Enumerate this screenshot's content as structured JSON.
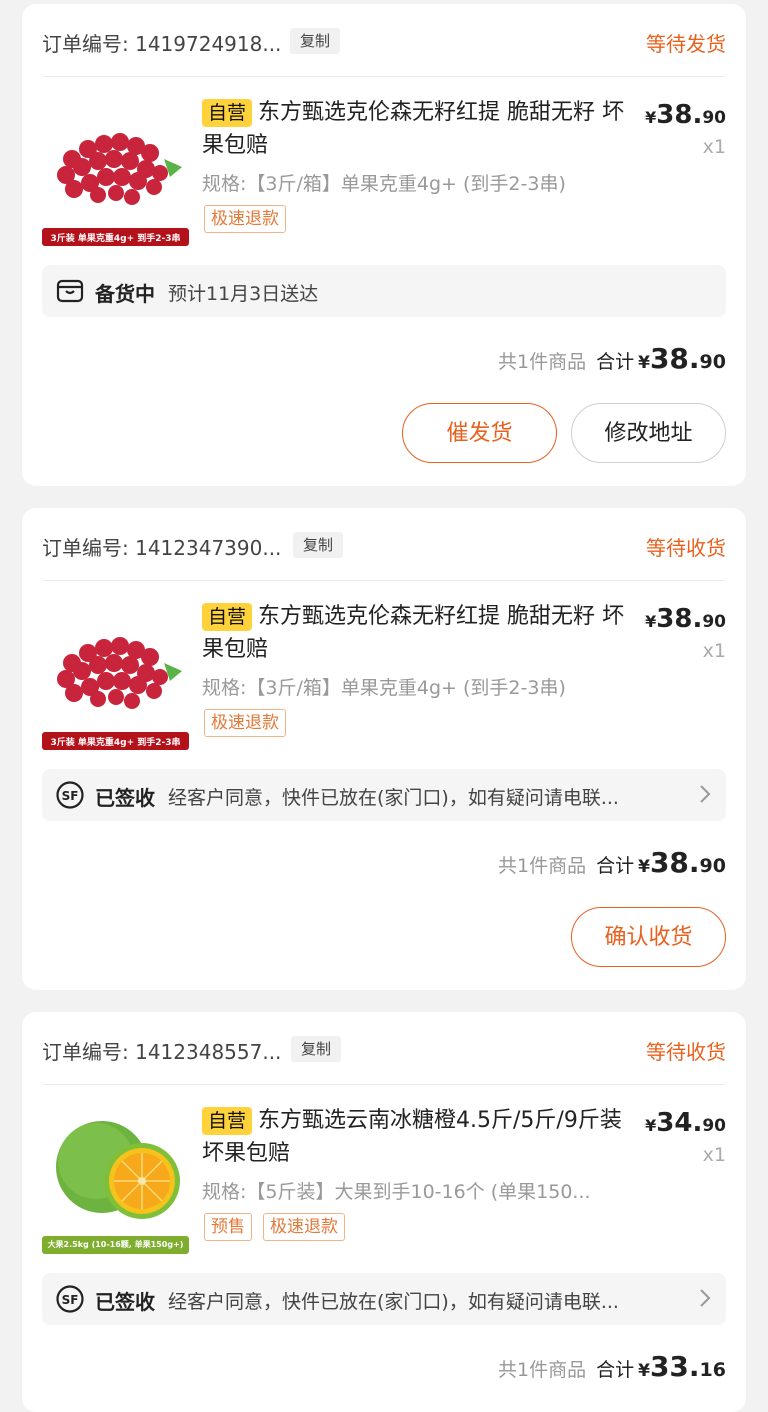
{
  "orders": [
    {
      "order_no_label": "订单编号: 1419724918...",
      "copy_label": "复制",
      "status": "等待发货",
      "self_tag": "自营",
      "product_title": "东方甄选克伦森无籽红提 脆甜无籽 坏果包赔",
      "spec": "规格:【3斤/箱】单果克重4g+ (到手2-3串)",
      "tags": [
        "极速退款"
      ],
      "price_currency": "¥",
      "price_int": "38.",
      "price_dec": "90",
      "qty": "x1",
      "image_caption": "3斤装 单果克重4g+ 到手2-3串",
      "image_icon": "grape-icon",
      "logistics_icon": "package-box-icon",
      "logistics_status": "备货中",
      "logistics_text": "预计11月3日送达",
      "summary_count": "共1件商品",
      "summary_label": "合计",
      "total_currency": "¥",
      "total_int": "38.",
      "total_dec": "90",
      "buttons": [
        "催发货",
        "修改地址"
      ]
    },
    {
      "order_no_label": "订单编号: 1412347390...",
      "copy_label": "复制",
      "status": "等待收货",
      "self_tag": "自营",
      "product_title": "东方甄选克伦森无籽红提 脆甜无籽 坏果包赔",
      "spec": "规格:【3斤/箱】单果克重4g+ (到手2-3串)",
      "tags": [
        "极速退款"
      ],
      "price_currency": "¥",
      "price_int": "38.",
      "price_dec": "90",
      "qty": "x1",
      "image_caption": "3斤装 单果克重4g+ 到手2-3串",
      "image_icon": "grape-icon",
      "logistics_icon": "sf-express-icon",
      "logistics_status": "已签收",
      "logistics_text": "经客户同意，快件已放在(家门口)，如有疑问请电联...",
      "summary_count": "共1件商品",
      "summary_label": "合计",
      "total_currency": "¥",
      "total_int": "38.",
      "total_dec": "90",
      "buttons": [
        "确认收货"
      ]
    },
    {
      "order_no_label": "订单编号: 1412348557...",
      "copy_label": "复制",
      "status": "等待收货",
      "self_tag": "自营",
      "product_title": "东方甄选云南冰糖橙4.5斤/5斤/9斤装 坏果包赔",
      "spec": "规格:【5斤装】大果到手10-16个 (单果150...",
      "tags": [
        "预售",
        "极速退款"
      ],
      "price_currency": "¥",
      "price_int": "34.",
      "price_dec": "90",
      "qty": "x1",
      "image_caption": "大果2.5kg (10-16颗, 单果150g+)",
      "image_icon": "orange-icon",
      "logistics_icon": "sf-express-icon",
      "logistics_status": "已签收",
      "logistics_text": "经客户同意，快件已放在(家门口)，如有疑问请电联...",
      "summary_count": "共1件商品",
      "summary_label": "合计",
      "total_currency": "¥",
      "total_int": "33.",
      "total_dec": "16"
    }
  ],
  "colors": {
    "accent": "#e8611f",
    "self_tag_bg": "#ffd23c",
    "page_bg": "#f2f2f2"
  }
}
